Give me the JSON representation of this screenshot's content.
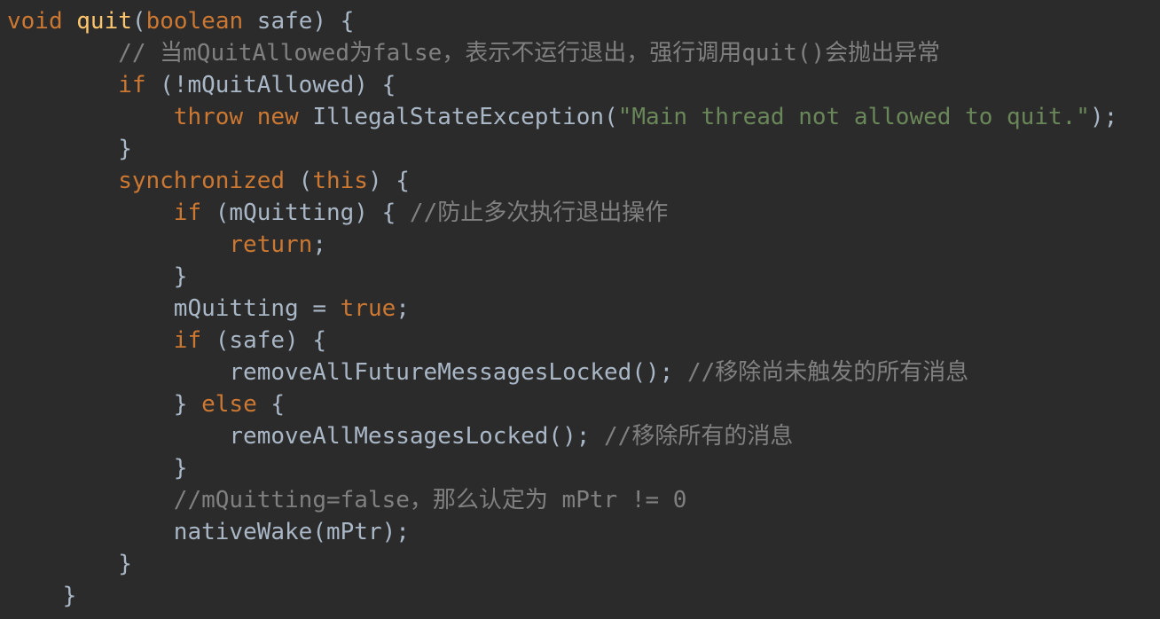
{
  "code_editor": {
    "language": "java",
    "colors": {
      "background": "#2b2b2b",
      "default": "#a9b7c6",
      "keyword": "#cc7832",
      "function": "#ffc66d",
      "string": "#6a8759",
      "comment": "#808080"
    },
    "lines": [
      {
        "indent": 0,
        "tokens": [
          {
            "t": "void",
            "k": "kw"
          },
          {
            "t": " ",
            "k": "id"
          },
          {
            "t": "quit",
            "k": "fn"
          },
          {
            "t": "(",
            "k": "id"
          },
          {
            "t": "boolean",
            "k": "kw"
          },
          {
            "t": " safe) {",
            "k": "id"
          }
        ]
      },
      {
        "indent": 8,
        "tokens": [
          {
            "t": "// 当mQuitAllowed为false，表示不运行退出，强行调用quit()会抛出异常",
            "k": "cm"
          }
        ]
      },
      {
        "indent": 8,
        "tokens": [
          {
            "t": "if",
            "k": "kw"
          },
          {
            "t": " (!mQuitAllowed) {",
            "k": "id"
          }
        ]
      },
      {
        "indent": 12,
        "tokens": [
          {
            "t": "throw",
            "k": "kw"
          },
          {
            "t": " ",
            "k": "id"
          },
          {
            "t": "new",
            "k": "kw"
          },
          {
            "t": " IllegalStateException(",
            "k": "id"
          },
          {
            "t": "\"Main thread not allowed to quit.\"",
            "k": "str"
          },
          {
            "t": ");",
            "k": "id"
          }
        ]
      },
      {
        "indent": 8,
        "tokens": [
          {
            "t": "}",
            "k": "id"
          }
        ]
      },
      {
        "indent": 8,
        "tokens": [
          {
            "t": "synchronized",
            "k": "kw"
          },
          {
            "t": " (",
            "k": "id"
          },
          {
            "t": "this",
            "k": "kw"
          },
          {
            "t": ") {",
            "k": "id"
          }
        ]
      },
      {
        "indent": 12,
        "tokens": [
          {
            "t": "if",
            "k": "kw"
          },
          {
            "t": " (mQuitting) { ",
            "k": "id"
          },
          {
            "t": "//防止多次执行退出操作",
            "k": "cm"
          }
        ]
      },
      {
        "indent": 16,
        "tokens": [
          {
            "t": "return",
            "k": "kw"
          },
          {
            "t": ";",
            "k": "id"
          }
        ]
      },
      {
        "indent": 12,
        "tokens": [
          {
            "t": "}",
            "k": "id"
          }
        ]
      },
      {
        "indent": 12,
        "tokens": [
          {
            "t": "mQuitting = ",
            "k": "id"
          },
          {
            "t": "true",
            "k": "kw"
          },
          {
            "t": ";",
            "k": "id"
          }
        ]
      },
      {
        "indent": 12,
        "tokens": [
          {
            "t": "if",
            "k": "kw"
          },
          {
            "t": " (safe) {",
            "k": "id"
          }
        ]
      },
      {
        "indent": 16,
        "tokens": [
          {
            "t": "removeAllFutureMessagesLocked(); ",
            "k": "id"
          },
          {
            "t": "//移除尚未触发的所有消息",
            "k": "cm"
          }
        ]
      },
      {
        "indent": 12,
        "tokens": [
          {
            "t": "} ",
            "k": "id"
          },
          {
            "t": "else",
            "k": "kw"
          },
          {
            "t": " {",
            "k": "id"
          }
        ]
      },
      {
        "indent": 16,
        "tokens": [
          {
            "t": "removeAllMessagesLocked(); ",
            "k": "id"
          },
          {
            "t": "//移除所有的消息",
            "k": "cm"
          }
        ]
      },
      {
        "indent": 12,
        "tokens": [
          {
            "t": "}",
            "k": "id"
          }
        ]
      },
      {
        "indent": 12,
        "tokens": [
          {
            "t": "//mQuitting=false，那么认定为 mPtr != 0",
            "k": "cm"
          }
        ]
      },
      {
        "indent": 12,
        "tokens": [
          {
            "t": "nativeWake(mPtr);",
            "k": "id"
          }
        ]
      },
      {
        "indent": 8,
        "tokens": [
          {
            "t": "}",
            "k": "id"
          }
        ]
      },
      {
        "indent": 4,
        "tokens": [
          {
            "t": "}",
            "k": "id"
          }
        ]
      }
    ]
  }
}
